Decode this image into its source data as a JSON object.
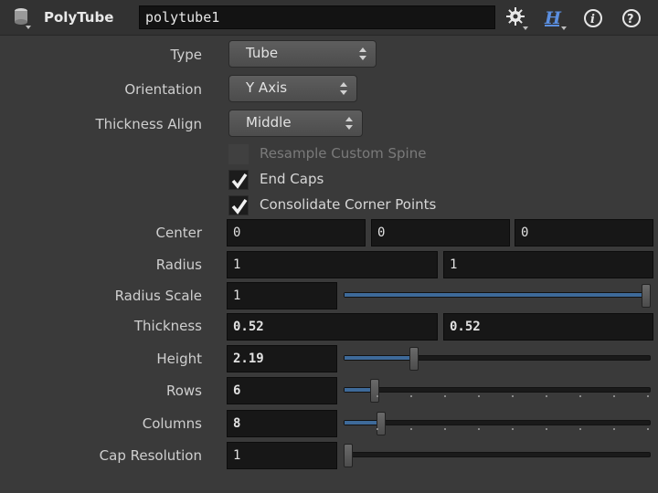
{
  "header": {
    "node_type": "PolyTube",
    "node_name": "polytube1",
    "icons": [
      "node-icon",
      "gear-icon",
      "houdini-help-icon",
      "info-icon",
      "help-icon"
    ]
  },
  "params": {
    "type": {
      "label": "Type",
      "value": "Tube"
    },
    "orientation": {
      "label": "Orientation",
      "value": "Y Axis"
    },
    "thickness_align": {
      "label": "Thickness Align",
      "value": "Middle"
    },
    "resample": {
      "label": "Resample Custom Spine",
      "checked": false,
      "enabled": false
    },
    "end_caps": {
      "label": "End Caps",
      "checked": true
    },
    "consolidate": {
      "label": "Consolidate Corner Points",
      "checked": true
    },
    "center": {
      "label": "Center",
      "values": [
        "0",
        "0",
        "0"
      ]
    },
    "radius": {
      "label": "Radius",
      "values": [
        "1",
        "1"
      ]
    },
    "radius_scale": {
      "label": "Radius Scale",
      "value": "1",
      "slider_level": 1.0
    },
    "thickness": {
      "label": "Thickness",
      "values": [
        "0.52",
        "0.52"
      ]
    },
    "height": {
      "label": "Height",
      "value": "2.19",
      "slider_level": 0.22
    },
    "rows": {
      "label": "Rows",
      "value": "6",
      "slider_level": 0.09
    },
    "columns": {
      "label": "Columns",
      "value": "8",
      "slider_level": 0.11
    },
    "cap_resolution": {
      "label": "Cap Resolution",
      "value": "1",
      "slider_level": 0.0
    }
  },
  "colors": {
    "background": "#3a3a3a",
    "field": "#171717",
    "slider_fill": "#3e6a99"
  }
}
